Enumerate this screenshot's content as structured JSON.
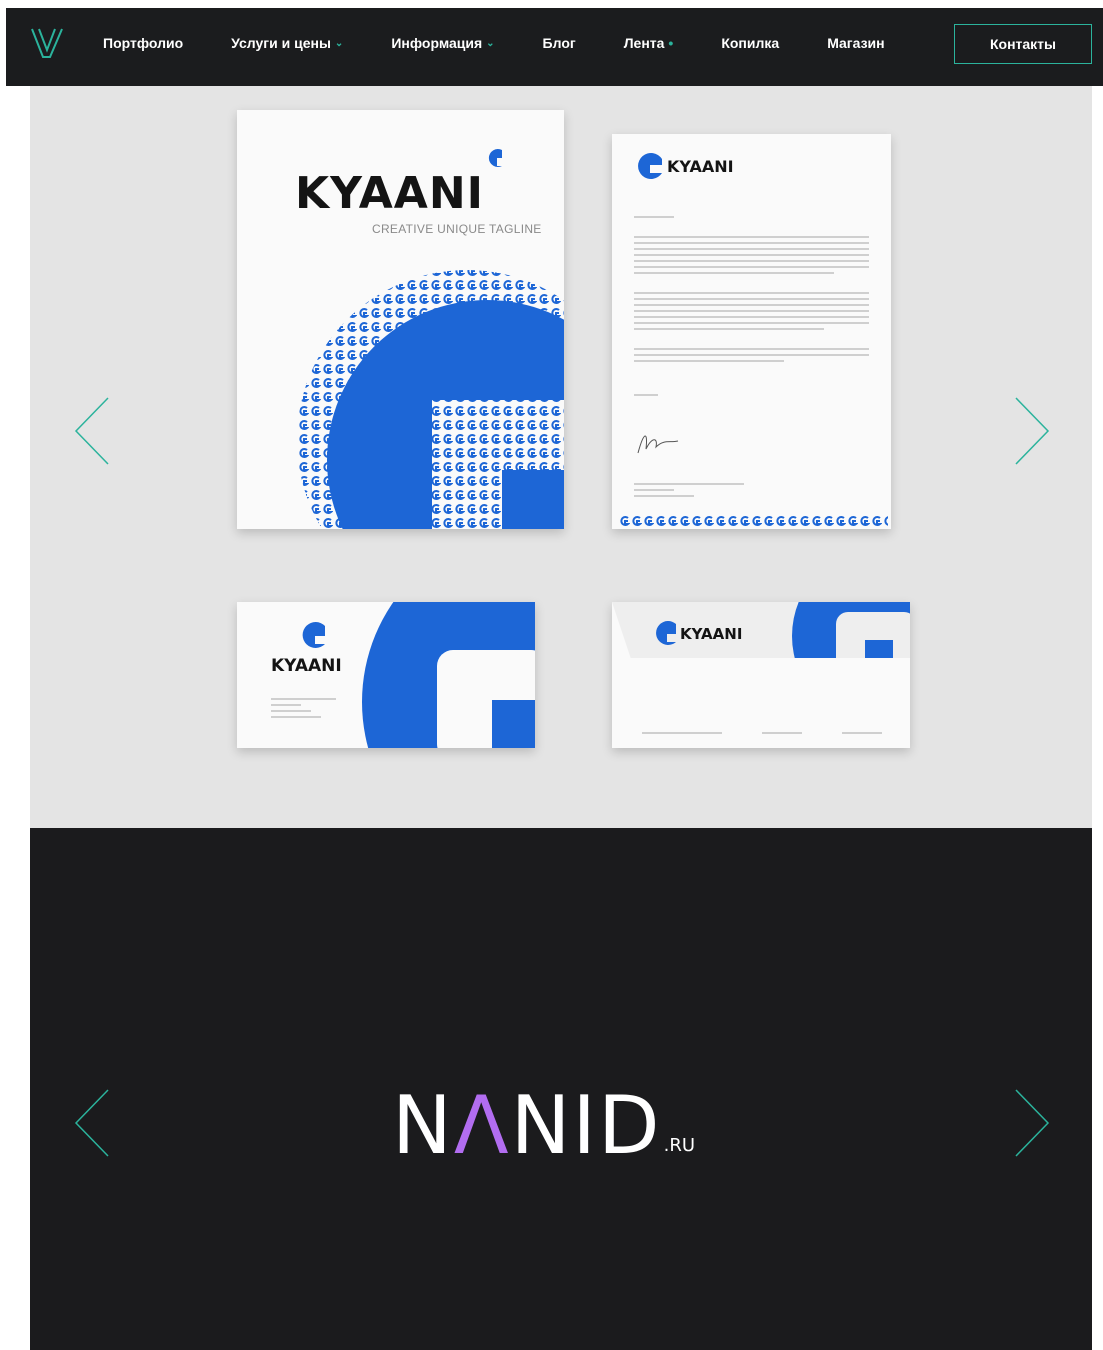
{
  "header": {
    "nav": [
      {
        "label": "Портфолио",
        "caret": ""
      },
      {
        "label": "Услуги и цены",
        "caret": "⌄"
      },
      {
        "label": "Информация",
        "caret": "⌄"
      },
      {
        "label": "Блог",
        "caret": ""
      },
      {
        "label": "Лента",
        "caret": "•"
      },
      {
        "label": "Копилка",
        "caret": ""
      },
      {
        "label": "Магазин",
        "caret": ""
      }
    ],
    "contacts_label": "Контакты",
    "logo_icon": "v-logo-icon"
  },
  "slide1": {
    "book": {
      "brand": "KYAANI",
      "tagline": "CREATIVE UNIQUE TAGLINE"
    },
    "letterhead": {
      "brand": "KYAANI"
    },
    "business_card": {
      "brand": "KYAANI"
    },
    "envelope": {
      "brand": "KYAANI"
    }
  },
  "slide2": {
    "brand_before": "N",
    "brand_accent": "Λ",
    "brand_after": "NID",
    "brand_tld": ".RU"
  },
  "colors": {
    "accent": "#2bb39c",
    "brand_blue": "#1d66d6",
    "brand_purple": "#b26df0",
    "header_bg": "#1b1c1e",
    "slide1_bg": "#e4e4e4",
    "slide2_bg": "#1b1b1d"
  }
}
